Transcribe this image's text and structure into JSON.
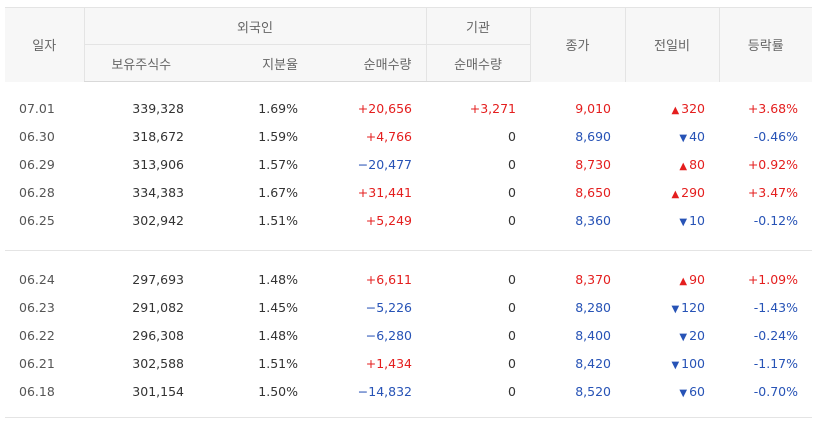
{
  "header": {
    "date": "일자",
    "foreign": "외국인",
    "institution": "기관",
    "close": "종가",
    "change": "전일비",
    "rate": "등락률",
    "holdings": "보유주식수",
    "share": "지분율",
    "foreign_net": "순매수량",
    "inst_net": "순매수량"
  },
  "groups": [
    [
      {
        "date": "07.01",
        "holdings": "339,328",
        "share": "1.69%",
        "foreign_net": "+20,656",
        "foreign_dir": "up",
        "inst_net": "+3,271",
        "inst_dir": "up",
        "close": "9,010",
        "close_dir": "up",
        "arrow": "▲",
        "change": "320",
        "change_dir": "up",
        "rate": "+3.68%",
        "rate_dir": "up"
      },
      {
        "date": "06.30",
        "holdings": "318,672",
        "share": "1.59%",
        "foreign_net": "+4,766",
        "foreign_dir": "up",
        "inst_net": "0",
        "inst_dir": "none",
        "close": "8,690",
        "close_dir": "down",
        "arrow": "▼",
        "change": "40",
        "change_dir": "down",
        "rate": "-0.46%",
        "rate_dir": "down"
      },
      {
        "date": "06.29",
        "holdings": "313,906",
        "share": "1.57%",
        "foreign_net": "−20,477",
        "foreign_dir": "down",
        "inst_net": "0",
        "inst_dir": "none",
        "close": "8,730",
        "close_dir": "up",
        "arrow": "▲",
        "change": "80",
        "change_dir": "up",
        "rate": "+0.92%",
        "rate_dir": "up"
      },
      {
        "date": "06.28",
        "holdings": "334,383",
        "share": "1.67%",
        "foreign_net": "+31,441",
        "foreign_dir": "up",
        "inst_net": "0",
        "inst_dir": "none",
        "close": "8,650",
        "close_dir": "up",
        "arrow": "▲",
        "change": "290",
        "change_dir": "up",
        "rate": "+3.47%",
        "rate_dir": "up"
      },
      {
        "date": "06.25",
        "holdings": "302,942",
        "share": "1.51%",
        "foreign_net": "+5,249",
        "foreign_dir": "up",
        "inst_net": "0",
        "inst_dir": "none",
        "close": "8,360",
        "close_dir": "down",
        "arrow": "▼",
        "change": "10",
        "change_dir": "down",
        "rate": "-0.12%",
        "rate_dir": "down"
      }
    ],
    [
      {
        "date": "06.24",
        "holdings": "297,693",
        "share": "1.48%",
        "foreign_net": "+6,611",
        "foreign_dir": "up",
        "inst_net": "0",
        "inst_dir": "none",
        "close": "8,370",
        "close_dir": "up",
        "arrow": "▲",
        "change": "90",
        "change_dir": "up",
        "rate": "+1.09%",
        "rate_dir": "up"
      },
      {
        "date": "06.23",
        "holdings": "291,082",
        "share": "1.45%",
        "foreign_net": "−5,226",
        "foreign_dir": "down",
        "inst_net": "0",
        "inst_dir": "none",
        "close": "8,280",
        "close_dir": "down",
        "arrow": "▼",
        "change": "120",
        "change_dir": "down",
        "rate": "-1.43%",
        "rate_dir": "down"
      },
      {
        "date": "06.22",
        "holdings": "296,308",
        "share": "1.48%",
        "foreign_net": "−6,280",
        "foreign_dir": "down",
        "inst_net": "0",
        "inst_dir": "none",
        "close": "8,400",
        "close_dir": "down",
        "arrow": "▼",
        "change": "20",
        "change_dir": "down",
        "rate": "-0.24%",
        "rate_dir": "down"
      },
      {
        "date": "06.21",
        "holdings": "302,588",
        "share": "1.51%",
        "foreign_net": "+1,434",
        "foreign_dir": "up",
        "inst_net": "0",
        "inst_dir": "none",
        "close": "8,420",
        "close_dir": "down",
        "arrow": "▼",
        "change": "100",
        "change_dir": "down",
        "rate": "-1.17%",
        "rate_dir": "down"
      },
      {
        "date": "06.18",
        "holdings": "301,154",
        "share": "1.50%",
        "foreign_net": "−14,832",
        "foreign_dir": "down",
        "inst_net": "0",
        "inst_dir": "none",
        "close": "8,520",
        "close_dir": "down",
        "arrow": "▼",
        "change": "60",
        "change_dir": "down",
        "rate": "-0.70%",
        "rate_dir": "down"
      }
    ]
  ],
  "colors": {
    "up": "#e41e1e",
    "down": "#2753b6"
  }
}
